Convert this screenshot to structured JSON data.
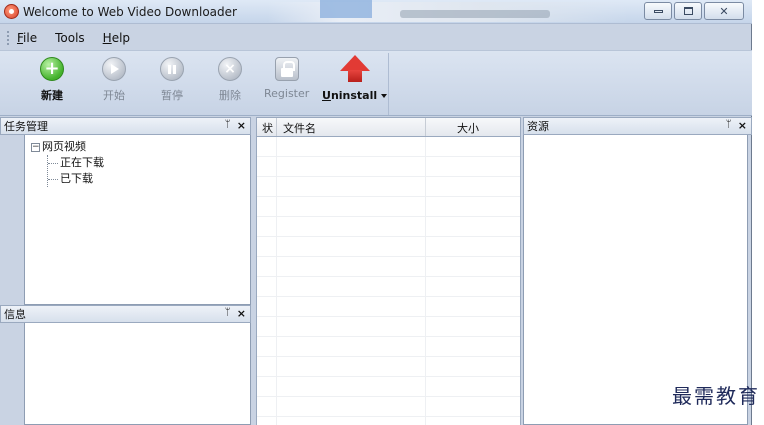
{
  "window": {
    "title": "Welcome to Web Video Downloader"
  },
  "menu": {
    "file": {
      "mnemonic": "F",
      "rest": "ile"
    },
    "tools": "Tools",
    "help": {
      "mnemonic": "H",
      "rest": "elp"
    }
  },
  "toolbar": {
    "new_label": "新建",
    "start_label": "开始",
    "pause_label": "暂停",
    "delete_label": "删除",
    "register_label": "Register",
    "uninstall_label": {
      "mnemonic": "U",
      "rest": "ninstall"
    }
  },
  "task_panel": {
    "title": "任务管理",
    "tree": {
      "root": "网页视频",
      "children": [
        "正在下载",
        "已下载"
      ],
      "root_expander": "−"
    }
  },
  "info_panel": {
    "title": "信息"
  },
  "file_list": {
    "columns": [
      "状",
      "文件名",
      "大小"
    ]
  },
  "resource_panel": {
    "title": "资源"
  },
  "panel_controls": {
    "pin": "ᛘ",
    "close": "×"
  },
  "watermark": "最需教育"
}
